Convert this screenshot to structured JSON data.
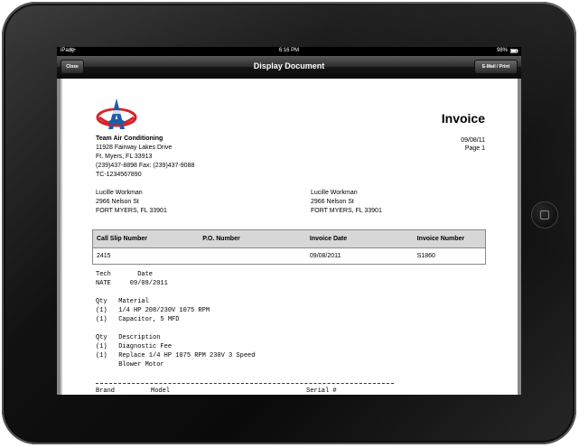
{
  "status_bar": {
    "device": "iPad",
    "time": "6:16 PM",
    "battery": "98%"
  },
  "nav": {
    "close_label": "Close",
    "title": "Display Document",
    "email_print_label": "E-Mail / Print"
  },
  "invoice": {
    "title": "Invoice",
    "date": "09/08/11",
    "page": "Page 1",
    "company": {
      "name": "Team Air Conditioning",
      "address1": "11928 Fairway Lakes Drive",
      "address2": "Ft. Myers, FL 33913",
      "phone_fax": "(239)437-8898  Fax: (239)437-9088",
      "license": "TC-1234567890"
    },
    "bill_to": {
      "name": "Lucille Workman",
      "street": "2966 Nelson St",
      "city": "FORT MYERS, FL 33901"
    },
    "ship_to": {
      "name": "Lucille Workman",
      "street": "2966 Nelson St",
      "city": "FORT MYERS, FL 33901"
    },
    "table": {
      "headers": [
        "Call Slip Number",
        "P.O. Number",
        "Invoice Date",
        "Invoice Number"
      ],
      "row": [
        "2415",
        "",
        "09/08/2011",
        "S1860"
      ]
    },
    "tech_block": {
      "header": "Tech       Date",
      "value": "NATE     09/08/2011"
    },
    "material_block": {
      "header": "Qty   Material",
      "lines": [
        "(1)   1/4 HP 208/230V 1075 RPM",
        "(1)   Capacitor, 5 MFD"
      ]
    },
    "description_block": {
      "header": "Qty   Description",
      "lines": [
        "(1)   Diagnostic Fee",
        "(1)   Replace 1/4 HP 1075 RPM 230V 3 Speed",
        "      Blower Motor"
      ]
    },
    "equipment_header": {
      "brand": "Brand",
      "model": "Model",
      "serial": "Serial #"
    }
  },
  "colors": {
    "nav_bar": "#1e1e1e",
    "table_header": "#d7d7d7",
    "logo_blue": "#1d5ca8",
    "logo_red": "#d4232b"
  }
}
